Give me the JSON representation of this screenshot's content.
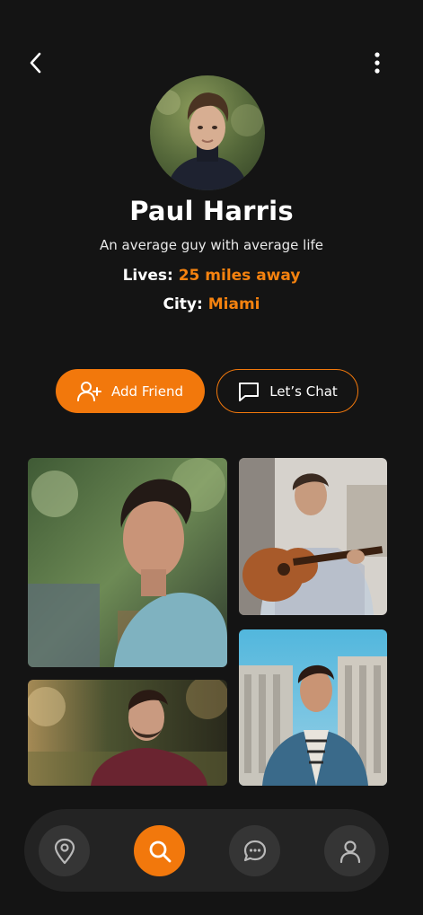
{
  "profile": {
    "name": "Paul Harris",
    "bio": "An average guy with average life",
    "lives_label": "Lives:",
    "lives_value": "25 miles away",
    "city_label": "City:",
    "city_value": "Miami"
  },
  "actions": {
    "add_friend_label": "Add Friend",
    "chat_label": "Let’s Chat"
  },
  "colors": {
    "accent": "#f2780c",
    "background": "#141414",
    "nav_bar": "#232323",
    "nav_button": "#353535"
  },
  "icons": {
    "back": "chevron-left-icon",
    "menu": "more-vertical-icon",
    "add_friend": "user-plus-icon",
    "chat": "message-square-icon",
    "nav": [
      "location-pin-icon",
      "search-icon",
      "chat-bubble-icon",
      "user-icon"
    ]
  },
  "bottom_nav": {
    "active_index": 1
  }
}
